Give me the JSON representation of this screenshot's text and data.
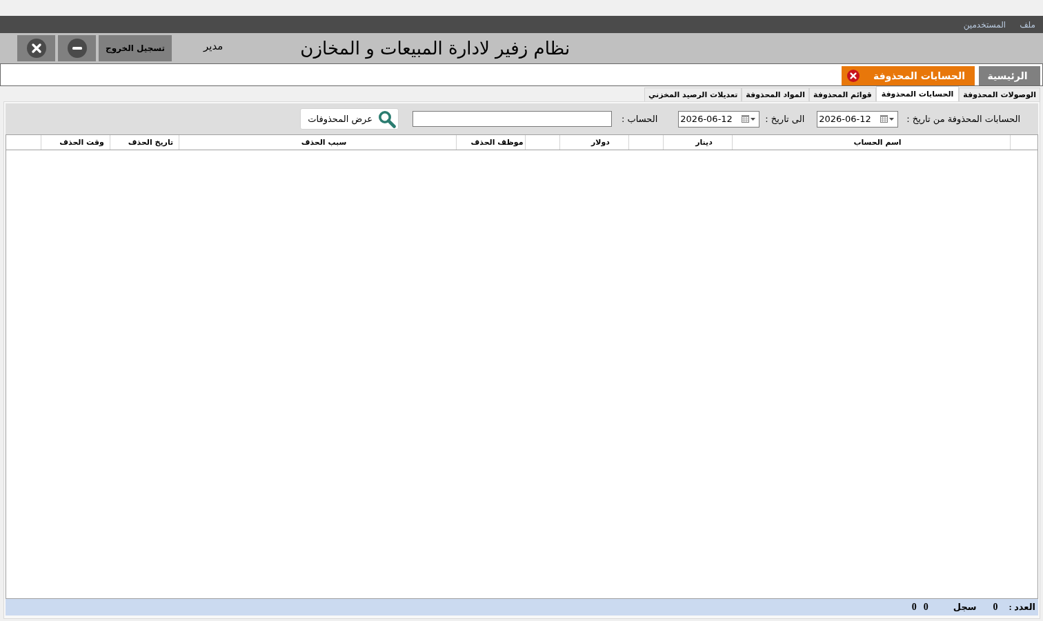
{
  "menu_bar": [
    "ملف",
    "المستخدمين"
  ],
  "header": {
    "title": "نظام زفير لادارة المبيعات و المخازن",
    "user": "مدير",
    "logout_button": "تسجيل الخروج"
  },
  "main_tabs": [
    {
      "label": "الرئيسية",
      "selected": false,
      "closable": false
    },
    {
      "label": "الحسابات المحذوفة",
      "selected": true,
      "closable": true
    }
  ],
  "sub_tabs": [
    {
      "label": "الوصولات المحذوفة",
      "selected": false
    },
    {
      "label": "الحسابات المحذوفة",
      "selected": true
    },
    {
      "label": "قوائم المحذوفة",
      "selected": false
    },
    {
      "label": "المواد المحذوفة",
      "selected": false
    },
    {
      "label": "تعديلات الرصيد المخزني",
      "selected": false
    }
  ],
  "filter": {
    "from_label": "الحسابات المحذوفة من تاريخ :",
    "from_date": "2026-06-12",
    "to_label": "الى تاريخ :",
    "to_date": "2026-06-12",
    "account_label": "الحساب :",
    "show_button": "عرض المحذوفات"
  },
  "table": {
    "columns": [
      {
        "kind": "blank"
      },
      {
        "kind": "label",
        "label": "اسم الحساب"
      },
      {
        "kind": "label",
        "label": "دينار"
      },
      {
        "kind": "blank"
      },
      {
        "kind": "label",
        "label": "دولار"
      },
      {
        "kind": "blank"
      },
      {
        "kind": "label",
        "label": "موظف الحذف"
      },
      {
        "kind": "label",
        "label": "سبب الحذف"
      },
      {
        "kind": "label",
        "label": "تاريخ الحذف"
      },
      {
        "kind": "label",
        "label": "وقت الحذف"
      },
      {
        "kind": "blank"
      }
    ]
  },
  "status_bar": {
    "count_label": "العدد :",
    "count": "0",
    "records_label": "سجل",
    "totals": [
      "0",
      "0"
    ]
  }
}
